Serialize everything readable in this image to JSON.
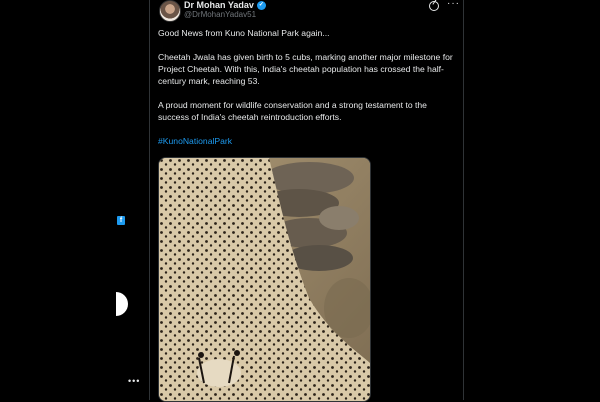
{
  "author": {
    "display_name": "Dr Mohan Yadav",
    "handle": "@DrMohanYadav51"
  },
  "tweet": {
    "paragraph_1": "Good News from Kuno National Park again...",
    "paragraph_2": "Cheetah Jwala has given birth to 5 cubs, marking another major milestone for Project Cheetah. With this, India's cheetah population has crossed the half-century mark, reaching 53.",
    "paragraph_3": "A proud moment for wildlife conservation and a strong testament to the success of India's cheetah reintroduction efforts.",
    "hashtag": "#KunoNationalPark"
  },
  "icons": {
    "verified": "verified-badge-icon",
    "grok": "grok-icon",
    "more": "more-options-icon",
    "facebook": "facebook-icon"
  },
  "media": {
    "subject": "cheetah-with-cubs-photo"
  },
  "colors": {
    "background": "#000000",
    "text": "#e7e9ea",
    "secondary_text": "#71767b",
    "link": "#1d9bf0",
    "divider": "#2f3336"
  }
}
